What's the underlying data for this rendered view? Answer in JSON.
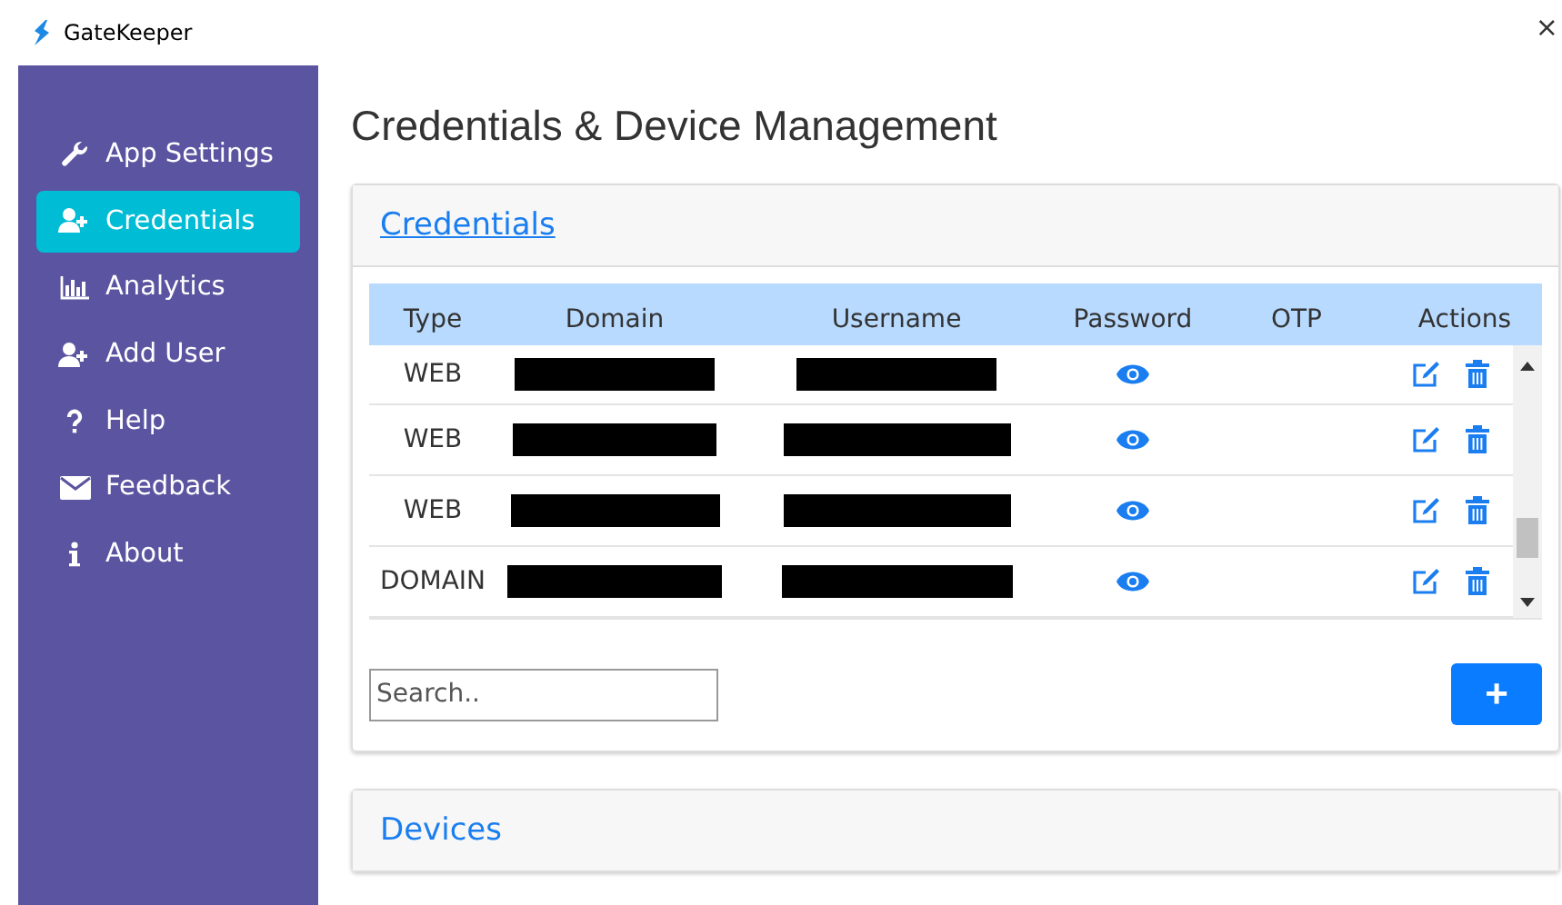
{
  "window": {
    "title": "GateKeeper",
    "close": "×"
  },
  "sidebar": {
    "items": [
      {
        "label": "App Settings",
        "selected": false
      },
      {
        "label": "Credentials",
        "selected": true
      },
      {
        "label": "Analytics",
        "selected": false
      },
      {
        "label": "Add User",
        "selected": false
      },
      {
        "label": "Help",
        "selected": false
      },
      {
        "label": "Feedback",
        "selected": false
      },
      {
        "label": "About",
        "selected": false
      }
    ]
  },
  "page_title": "Credentials & Device Management",
  "credentials": {
    "title": "Credentials",
    "table": {
      "columns": [
        "Type",
        "Domain",
        "Username",
        "Password",
        "OTP",
        "Actions"
      ],
      "rows": [
        {
          "type": "WEB",
          "domain_redacted": true,
          "username_redacted": true
        },
        {
          "type": "WEB",
          "domain_redacted": true,
          "username_redacted": true
        },
        {
          "type": "WEB",
          "domain_redacted": true,
          "username_redacted": true
        },
        {
          "type": "DOMAIN",
          "domain_redacted": true,
          "username_redacted": true
        }
      ]
    },
    "search": {
      "placeholder": "Search.."
    },
    "add_button": "+"
  },
  "devices": {
    "title": "Devices"
  }
}
